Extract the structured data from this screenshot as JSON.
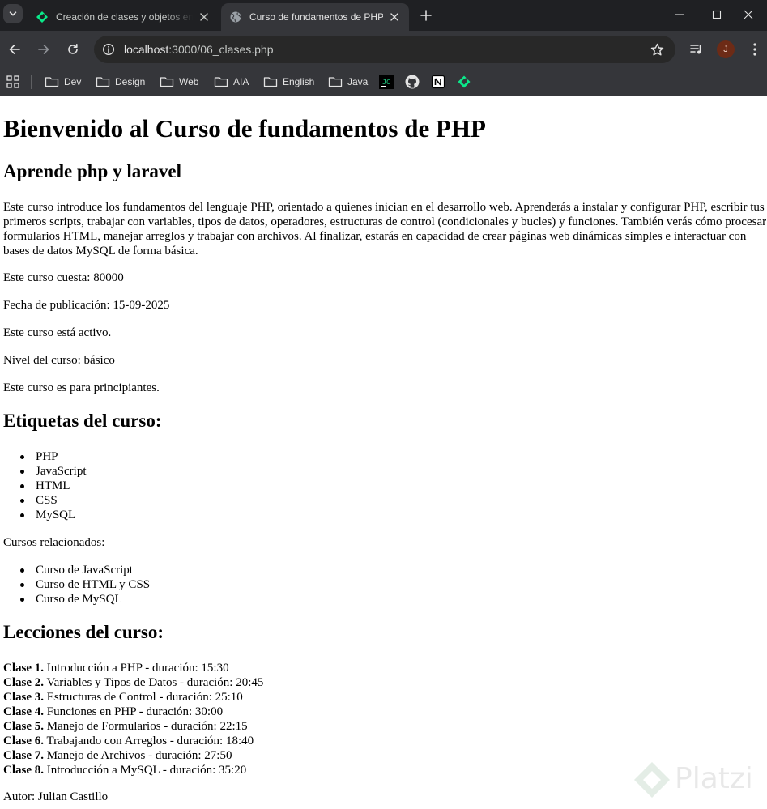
{
  "browser": {
    "tabs": [
      {
        "title": "Creación de clases y objetos en PHP",
        "favicon": "platzi-icon",
        "active": false
      },
      {
        "title": "Curso de fundamentos de PHP",
        "favicon": "globe-icon",
        "active": true
      }
    ],
    "address": {
      "host": "localhost",
      "path": ":3000/06_clases.php"
    },
    "profile_initial": "J",
    "bookmarks": [
      {
        "label": "Dev",
        "type": "folder"
      },
      {
        "label": "Design",
        "type": "folder"
      },
      {
        "label": "Web",
        "type": "folder"
      },
      {
        "label": "AIA",
        "type": "folder"
      },
      {
        "label": "English",
        "type": "folder"
      },
      {
        "label": "Java",
        "type": "folder"
      }
    ],
    "bookmark_icons": [
      "jc-icon",
      "github-icon",
      "notion-icon",
      "platzi-icon"
    ],
    "accent": "#0ae98a"
  },
  "page": {
    "title": "Bienvenido al Curso de fundamentos de PHP",
    "subtitle": "Aprende php y laravel",
    "description": "Este curso introduce los fundamentos del lenguaje PHP, orientado a quienes inician en el desarrollo web. Aprenderás a instalar y configurar PHP, escribir tus primeros scripts, trabajar con variables, tipos de datos, operadores, estructuras de control (condicionales y bucles) y funciones. También verás cómo procesar formularios HTML, manejar arreglos y trabajar con archivos. Al finalizar, estarás en capacidad de crear páginas web dinámicas simples e interactuar con bases de datos MySQL de forma básica.",
    "price": "Este curso cuesta: 80000",
    "published": "Fecha de publicación: 15-09-2025",
    "status": "Este curso está activo.",
    "level": "Nivel del curso: básico",
    "audience": "Este curso es para principiantes.",
    "tags_heading": "Etiquetas del curso:",
    "tags": [
      "PHP",
      "JavaScript",
      "HTML",
      "CSS",
      "MySQL"
    ],
    "related_label": "Cursos relacionados:",
    "related": [
      "Curso de JavaScript",
      "Curso de HTML y CSS",
      "Curso de MySQL"
    ],
    "lessons_heading": "Lecciones del curso:",
    "lessons": [
      {
        "label": "Clase 1.",
        "text": " Introducción a PHP - duración: 15:30"
      },
      {
        "label": "Clase 2.",
        "text": " Variables y Tipos de Datos - duración: 20:45"
      },
      {
        "label": "Clase 3.",
        "text": " Estructuras de Control - duración: 25:10"
      },
      {
        "label": "Clase 4.",
        "text": " Funciones en PHP - duración: 30:00"
      },
      {
        "label": "Clase 5.",
        "text": " Manejo de Formularios - duración: 22:15"
      },
      {
        "label": "Clase 6.",
        "text": " Trabajando con Arreglos - duración: 18:40"
      },
      {
        "label": "Clase 7.",
        "text": " Manejo de Archivos - duración: 27:50"
      },
      {
        "label": "Clase 8.",
        "text": " Introducción a MySQL - duración: 35:20"
      }
    ],
    "author": "Autor: Julian Castillo",
    "watermark": "Platzi"
  }
}
